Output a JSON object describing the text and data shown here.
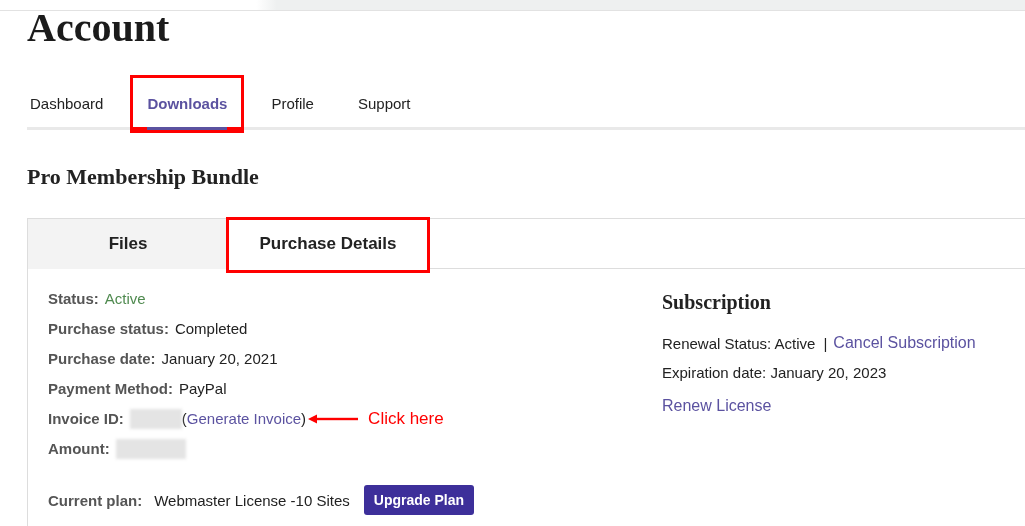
{
  "page_title": "Account",
  "nav_tabs": [
    {
      "label": "Dashboard",
      "selected": false,
      "annotated": false
    },
    {
      "label": "Downloads",
      "selected": true,
      "annotated": true
    },
    {
      "label": "Profile",
      "selected": false,
      "annotated": false
    },
    {
      "label": "Support",
      "selected": false,
      "annotated": false
    }
  ],
  "product_title": "Pro Membership Bundle",
  "detail_tabs": [
    {
      "label": "Files",
      "selected": false,
      "annotated": false
    },
    {
      "label": "Purchase Details",
      "selected": true,
      "annotated": true
    }
  ],
  "details": [
    {
      "kind": "status",
      "label": "Status:",
      "value": "Active"
    },
    {
      "kind": "text",
      "label": "Purchase status:",
      "value": "Completed"
    },
    {
      "kind": "text",
      "label": "Purchase date:",
      "value": "January 20, 2021"
    },
    {
      "kind": "text",
      "label": "Payment Method:",
      "value": "PayPal"
    },
    {
      "kind": "invoice",
      "label": "Invoice ID:",
      "open": "(",
      "link": "Generate Invoice",
      "close": ")",
      "note": "Click here"
    },
    {
      "kind": "redacted",
      "label": "Amount:"
    }
  ],
  "plan": {
    "label": "Current plan:",
    "value": "Webmaster License -10 Sites",
    "button": "Upgrade Plan"
  },
  "subscription": {
    "title": "Subscription",
    "renewal": "Renewal Status: Active",
    "separator": "|",
    "cancel_link": "Cancel Subscription",
    "expiration": "Expiration date: January 20, 2023",
    "renew_link": "Renew License"
  }
}
